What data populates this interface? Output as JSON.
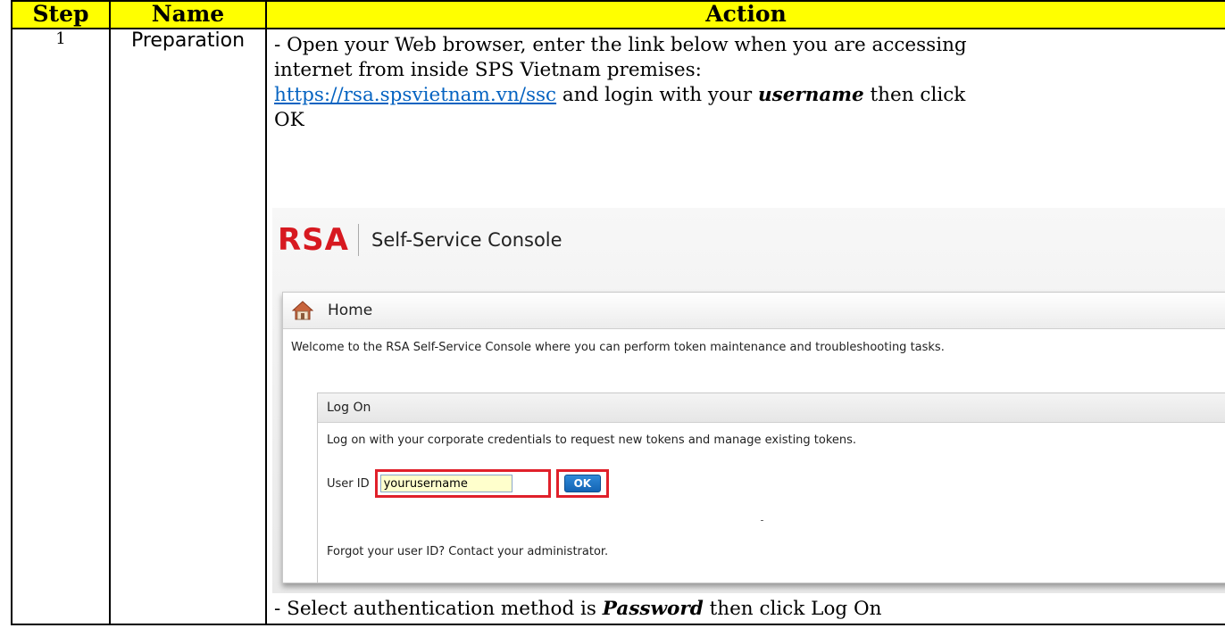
{
  "table": {
    "headers": {
      "step": "Step",
      "name": "Name",
      "action": "Action"
    },
    "row": {
      "step": "1",
      "name": "Preparation",
      "action": {
        "line1": "- Open your Web browser, enter the link below when you are accessing",
        "line2": "internet from inside SPS Vietnam premises:",
        "link": "https://rsa.spsvietnam.vn/ssc",
        "line3_mid": " and login with your ",
        "line3_bold": "username",
        "line3_end": " then click",
        "line4": "OK",
        "bottom_prefix": "- Select authentication method is ",
        "bottom_bold": "Password",
        "bottom_suffix": " then click Log On"
      }
    }
  },
  "rsa": {
    "logo": "RSA",
    "console_title": "Self-Service Console",
    "home_label": "Home",
    "welcome": "Welcome to the RSA Self-Service Console where you can perform token maintenance and troubleshooting tasks.",
    "logon_title": "Log On",
    "logon_desc": "Log on with your corporate credentials to request new tokens and manage existing tokens.",
    "userid_label": "User ID",
    "userid_value": "yourusername",
    "ok_label": "OK",
    "forgot": "Forgot your user ID? Contact your administrator."
  },
  "colors": {
    "header_bg": "#ffff00",
    "link": "#0563c1",
    "rsa_red": "#d71920",
    "highlight_box": "#e0202a",
    "ok_blue": "#1464b4"
  }
}
